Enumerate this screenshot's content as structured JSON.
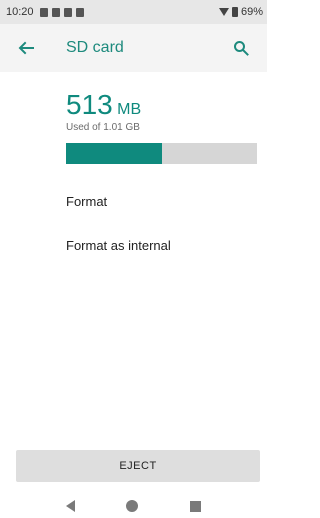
{
  "status_bar": {
    "time": "10:20",
    "battery_percent": "69%",
    "icons": [
      "notification-icon",
      "notification-icon",
      "notification-icon",
      "sd-card-icon",
      "wifi-icon",
      "battery-icon"
    ]
  },
  "toolbar": {
    "title": "SD card",
    "back_icon": "arrow-left-icon",
    "search_icon": "search-icon"
  },
  "storage": {
    "used_value": "513",
    "used_unit": "MB",
    "used_of_text": "Used of 1.01 GB",
    "progress_fraction": 0.5
  },
  "menu": {
    "items": [
      {
        "label": "Format"
      },
      {
        "label": "Format as internal"
      }
    ]
  },
  "eject_label": "EJECT",
  "colors": {
    "accent": "#0f8a7e",
    "toolbar_bg": "#f4f4f4",
    "status_bg": "#e7e7e7"
  }
}
